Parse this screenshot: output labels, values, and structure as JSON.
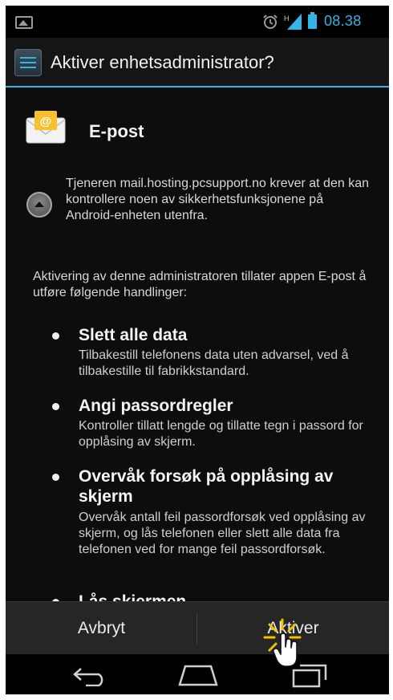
{
  "status_bar": {
    "time": "08.38",
    "network_label": "H",
    "icons": [
      "gallery-icon",
      "alarm-icon",
      "signal-icon",
      "battery-icon"
    ]
  },
  "title_bar": {
    "title": "Aktiver enhetsadministrator?",
    "icon": "device-admin-icon"
  },
  "app": {
    "name": "E-post",
    "icon": "email-icon"
  },
  "info": {
    "text": "Tjeneren mail.hosting.pcsupport.no krever at den kan kontrollere noen av sikkerhetsfunksjonene på Android-enheten utenfra.",
    "icon": "collapse-arrow-icon"
  },
  "intro_text": "Aktivering av denne administratoren tillater appen E-post å utføre følgende handlinger:",
  "policies": [
    {
      "title": "Slett alle data",
      "description": "Tilbakestill telefonens data uten advarsel, ved å tilbakestille til fabrikkstandard."
    },
    {
      "title": "Angi passordregler",
      "description": "Kontroller tillatt lengde og tillatte tegn i passord for opplåsing av skjerm."
    },
    {
      "title": "Overvåk forsøk på opplåsing av skjerm",
      "description": "Overvåk antall feil passordforsøk ved opplåsing av skjerm, og lås telefonen eller slett alle data fra telefonen ved for mange feil passordforsøk."
    },
    {
      "title": "Lås skjermen",
      "description": ""
    }
  ],
  "buttons": {
    "cancel": "Avbryt",
    "activate": "Aktiver"
  },
  "nav_bar": {
    "icons": [
      "back-icon",
      "home-icon",
      "recent-apps-icon"
    ]
  },
  "colors": {
    "accent": "#33b5e5",
    "background": "#0d0d0d",
    "button_bar": "#262626"
  }
}
